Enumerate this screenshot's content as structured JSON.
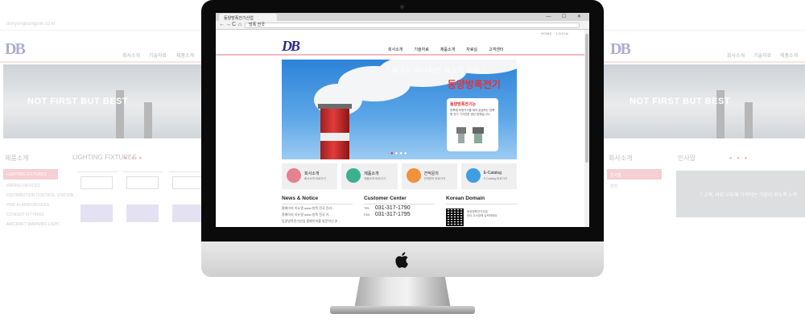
{
  "background": {
    "url_text": "donyangbangpok.co.kr",
    "nav_left": [
      "회사소개",
      "기술자료",
      "제품소개"
    ],
    "nav_right": [
      "회사소개",
      "기술자료",
      "제품소개"
    ],
    "slogan": "NOT FIRST BUT BEST",
    "dots": "● ● ●",
    "product_section_title": "제품소개",
    "lighting_title": "LIGHTING FIXTURES",
    "menu_active": "LIGHTING FIXTURES",
    "menu_items": [
      "WIRING DEVICES",
      "DISTRIBUTION CONTROL STATION",
      "FIRE ALARM DEVICES",
      "CONDUIT FITTINGS",
      "AIRCRAFT WARNING LIGHT"
    ],
    "company_section_title": "회사소개",
    "greeting_title": "인사말",
    "greeting_menu": [
      "인사말",
      "연혁"
    ],
    "greeting_quote": "\" 고객, 사회 모두에 기여하는 기업이 되도록 노력"
  },
  "browser": {
    "tab_title": "동양방폭전기산업",
    "window_controls": "— ☐ ✕",
    "url": "방폭 전국",
    "nav_back": "←",
    "nav_forward": "→",
    "nav_reload": "C",
    "nav_home": "⌂"
  },
  "site": {
    "utility_links": "HOME · LOGIN",
    "logo_text": "DB",
    "logo_sub": "",
    "nav": [
      "회사소개",
      "기술자료",
      "제품소개",
      "자료실",
      "고객센터"
    ],
    "hero": {
      "quote": "\" 최고는 아니지만 최고가 되자 \"",
      "title": "동양방폭전기",
      "card_title": "동양방폭전기는",
      "card_desc": "방폭형 조명기구를 제작 공급하는 방폭형 전기 기기전문 생산 업체입니다."
    },
    "slider_dots": [
      "active",
      "inactive",
      "inactive",
      "inactive"
    ],
    "quick_links": [
      {
        "label": "회사소개",
        "sub": "회사소개 바로가기",
        "color": "#e5828d"
      },
      {
        "label": "제품소개",
        "sub": "제품소개 바로가기",
        "color": "#3bb08f"
      },
      {
        "label": "견적문의",
        "sub": "견적문의 바로가기",
        "color": "#f0913c"
      },
      {
        "label": "E-Catalog",
        "sub": "E-Catalog 바로가기",
        "color": "#3f9ee0"
      }
    ],
    "news": {
      "title": "News & Notice",
      "items": [
        "홈페이지 리뉴얼 www 방폭 전국 진리...",
        "홈페이지 리뉴얼 www 방폭 전국 가...",
        "동양방폭전기산업 홈페이지를 방문하신 분..."
      ]
    },
    "customer": {
      "title": "Customer Center",
      "tel_label": "TEL.",
      "tel": "031-317-1790",
      "fax_label": "FAX.",
      "fax": "031-317-1795"
    },
    "korean_domain": {
      "title": "Korean Domain",
      "line1": "동양방폭전기산업",
      "line2": "인터 주소창에 입력하세요"
    }
  }
}
